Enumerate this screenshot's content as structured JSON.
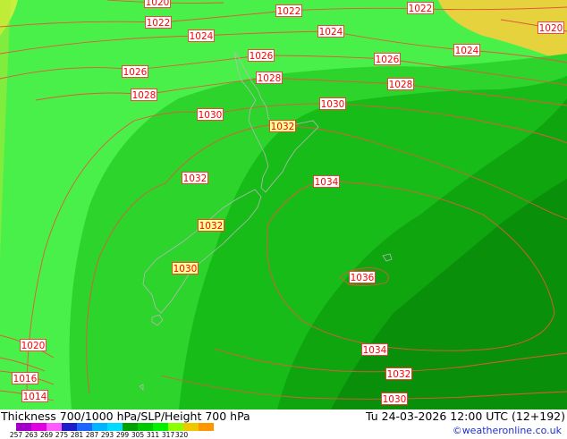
{
  "map": {
    "isobars": [
      {
        "label": "1020"
      },
      {
        "label": "1022"
      },
      {
        "label": "1022"
      },
      {
        "label": "1022"
      },
      {
        "label": "1020"
      },
      {
        "label": "1024"
      },
      {
        "label": "1024"
      },
      {
        "label": "1024"
      },
      {
        "label": "1026"
      },
      {
        "label": "1026"
      },
      {
        "label": "1026"
      },
      {
        "label": "1028"
      },
      {
        "label": "1028"
      },
      {
        "label": "1028"
      },
      {
        "label": "1030"
      },
      {
        "label": "1030"
      },
      {
        "label": "1032"
      },
      {
        "label": "1032"
      },
      {
        "label": "1034"
      },
      {
        "label": "1032"
      },
      {
        "label": "1030"
      },
      {
        "label": "1036"
      },
      {
        "label": "1020"
      },
      {
        "label": "1016"
      },
      {
        "label": "1014"
      },
      {
        "label": "1034"
      },
      {
        "label": "1032"
      },
      {
        "label": "1030"
      }
    ],
    "colors": {
      "isobar_line": "#e05a3a",
      "label_border": "#ff2020",
      "label_text": "#ff0000",
      "label_bg": "#ffffff",
      "label_bg_highlight": "#ffff99",
      "coastline": "#b8b8b8"
    }
  },
  "footer": {
    "title": "Thickness 700/1000 hPa/SLP/Height 700 hPa",
    "datetime": "Tu 24-03-2026 12:00 UTC (12+192)",
    "credit": "©weatheronline.co.uk",
    "legend": {
      "ticks": [
        "257",
        "263",
        "269",
        "275",
        "281",
        "287",
        "293",
        "299",
        "305",
        "311",
        "317",
        "320"
      ],
      "colors": [
        "#a200c8",
        "#e000e0",
        "#ff5aff",
        "#1e1ec8",
        "#1e64ff",
        "#00b4ff",
        "#00dcff",
        "#00a000",
        "#00c800",
        "#00f000",
        "#8cff00",
        "#f0c800",
        "#ff9600",
        "#ffffff"
      ]
    }
  }
}
